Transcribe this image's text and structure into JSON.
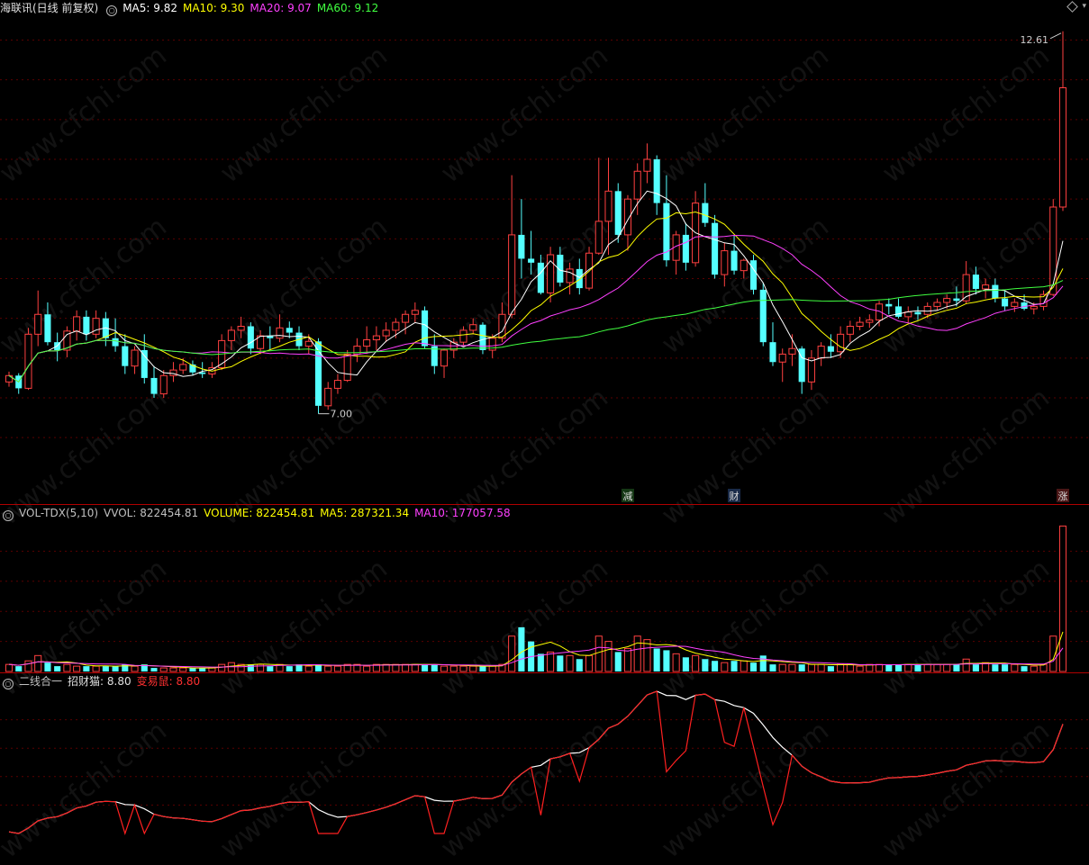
{
  "stock_name": "海联讯(日线 前复权)",
  "main_indicators": {
    "ma5": "MA5: 9.82",
    "ma10": "MA10: 9.30",
    "ma20": "MA20: 9.07",
    "ma60": "MA60: 9.12"
  },
  "price_labels": {
    "high": "12.61",
    "low": "7.00"
  },
  "event_markers": [
    "减",
    "财",
    "涨"
  ],
  "volume_panel": {
    "name": "VOL-TDX(5,10)",
    "vvol": "VVOL: 822454.81",
    "volume": "VOLUME: 822454.81",
    "ma5": "MA5: 287321.34",
    "ma10": "MA10: 177057.58"
  },
  "signal_panel": {
    "name": "二线合一",
    "line1": "招财猫: 8.80",
    "line2": "变易鼠: 8.80"
  },
  "watermark": "www.cfchi.com",
  "colors": {
    "up": "#ff4040",
    "down": "#54ffff",
    "ma5": "#ffffff",
    "ma10": "#ffff00",
    "ma20": "#ff40ff",
    "ma60": "#40ff40",
    "signal_white": "#ffffff",
    "signal_red": "#ff2020"
  },
  "chart_data": [
    {
      "type": "candlestick",
      "title": "海联讯(日线 前复权)",
      "ylim": [
        6.8,
        12.8
      ],
      "series": [
        {
          "name": "K",
          "ohlc": [
            [
              8.2,
              8.33,
              8.14,
              8.28
            ],
            [
              8.28,
              8.31,
              8.05,
              8.12
            ],
            [
              8.12,
              8.88,
              8.1,
              8.8
            ],
            [
              8.8,
              9.35,
              8.65,
              9.05
            ],
            [
              9.05,
              9.2,
              8.66,
              8.7
            ],
            [
              8.7,
              8.82,
              8.46,
              8.6
            ],
            [
              8.6,
              8.9,
              8.51,
              8.84
            ],
            [
              8.84,
              9.1,
              8.72,
              9.02
            ],
            [
              9.02,
              9.1,
              8.72,
              8.8
            ],
            [
              8.8,
              9.1,
              8.75,
              9.0
            ],
            [
              9.0,
              9.08,
              8.65,
              8.75
            ],
            [
              8.75,
              9.0,
              8.58,
              8.65
            ],
            [
              8.65,
              8.8,
              8.3,
              8.4
            ],
            [
              8.4,
              8.65,
              8.3,
              8.6
            ],
            [
              8.6,
              8.8,
              8.18,
              8.25
            ],
            [
              8.25,
              8.4,
              8.0,
              8.05
            ],
            [
              8.05,
              8.35,
              8.0,
              8.28
            ],
            [
              8.28,
              8.45,
              8.2,
              8.35
            ],
            [
              8.35,
              8.5,
              8.3,
              8.42
            ],
            [
              8.42,
              8.47,
              8.28,
              8.32
            ],
            [
              8.32,
              8.45,
              8.25,
              8.3
            ],
            [
              8.3,
              8.45,
              8.25,
              8.38
            ],
            [
              8.38,
              8.8,
              8.35,
              8.72
            ],
            [
              8.72,
              8.9,
              8.6,
              8.85
            ],
            [
              8.85,
              9.02,
              8.75,
              8.9
            ],
            [
              8.9,
              8.95,
              8.55,
              8.62
            ],
            [
              8.62,
              8.85,
              8.55,
              8.78
            ],
            [
              8.78,
              8.9,
              8.6,
              8.75
            ],
            [
              8.75,
              9.05,
              8.7,
              8.88
            ],
            [
              8.88,
              8.96,
              8.75,
              8.82
            ],
            [
              8.82,
              8.9,
              8.6,
              8.65
            ],
            [
              8.65,
              8.8,
              8.55,
              8.71
            ],
            [
              8.71,
              8.75,
              7.8,
              7.9
            ],
            [
              7.9,
              8.2,
              7.85,
              8.12
            ],
            [
              8.12,
              8.3,
              8.05,
              8.22
            ],
            [
              8.22,
              8.6,
              8.2,
              8.55
            ],
            [
              8.55,
              8.75,
              8.45,
              8.65
            ],
            [
              8.65,
              8.9,
              8.55,
              8.73
            ],
            [
              8.73,
              8.9,
              8.6,
              8.78
            ],
            [
              8.78,
              8.95,
              8.7,
              8.85
            ],
            [
              8.85,
              9.0,
              8.75,
              8.95
            ],
            [
              8.95,
              9.1,
              8.8,
              9.05
            ],
            [
              9.05,
              9.2,
              8.95,
              9.1
            ],
            [
              9.1,
              9.15,
              8.62,
              8.65
            ],
            [
              8.65,
              8.8,
              8.3,
              8.4
            ],
            [
              8.4,
              8.62,
              8.25,
              8.6
            ],
            [
              8.6,
              8.75,
              8.5,
              8.7
            ],
            [
              8.7,
              8.9,
              8.65,
              8.85
            ],
            [
              8.85,
              9.0,
              8.8,
              8.92
            ],
            [
              8.92,
              8.95,
              8.55,
              8.6
            ],
            [
              8.6,
              8.8,
              8.5,
              8.75
            ],
            [
              8.75,
              9.2,
              8.7,
              9.05
            ],
            [
              9.05,
              10.8,
              9.0,
              10.05
            ],
            [
              10.05,
              10.5,
              9.5,
              9.75
            ],
            [
              9.75,
              10.1,
              9.55,
              9.7
            ],
            [
              9.7,
              9.8,
              9.3,
              9.32
            ],
            [
              9.32,
              9.9,
              9.2,
              9.8
            ],
            [
              9.8,
              9.9,
              9.4,
              9.45
            ],
            [
              9.45,
              9.7,
              9.3,
              9.62
            ],
            [
              9.62,
              9.75,
              9.3,
              9.38
            ],
            [
              9.38,
              9.9,
              9.35,
              9.82
            ],
            [
              9.82,
              11.02,
              9.8,
              10.22
            ],
            [
              10.22,
              11.02,
              9.8,
              10.6
            ],
            [
              10.6,
              10.7,
              9.95,
              10.05
            ],
            [
              10.05,
              10.55,
              9.85,
              10.5
            ],
            [
              10.5,
              10.95,
              10.3,
              10.85
            ],
            [
              10.85,
              11.2,
              10.7,
              11.0
            ],
            [
              11.0,
              11.05,
              10.3,
              10.45
            ],
            [
              10.45,
              10.8,
              9.65,
              9.73
            ],
            [
              9.73,
              10.1,
              9.55,
              10.05
            ],
            [
              10.05,
              10.2,
              9.6,
              9.7
            ],
            [
              9.7,
              10.6,
              9.65,
              10.45
            ],
            [
              10.45,
              10.7,
              10.15,
              10.2
            ],
            [
              10.2,
              10.3,
              9.5,
              9.55
            ],
            [
              9.55,
              9.95,
              9.4,
              9.85
            ],
            [
              9.85,
              10.05,
              9.55,
              9.6
            ],
            [
              9.6,
              9.75,
              9.5,
              9.73
            ],
            [
              9.73,
              9.8,
              9.3,
              9.36
            ],
            [
              9.36,
              9.45,
              8.65,
              8.7
            ],
            [
              8.7,
              8.95,
              8.4,
              8.45
            ],
            [
              8.45,
              8.62,
              8.2,
              8.55
            ],
            [
              8.55,
              8.8,
              8.4,
              8.62
            ],
            [
              8.62,
              8.65,
              8.05,
              8.2
            ],
            [
              8.2,
              8.6,
              8.1,
              8.5
            ],
            [
              8.5,
              8.7,
              8.4,
              8.65
            ],
            [
              8.65,
              8.8,
              8.5,
              8.58
            ],
            [
              8.58,
              8.9,
              8.5,
              8.8
            ],
            [
              8.8,
              8.97,
              8.7,
              8.9
            ],
            [
              8.9,
              9.02,
              8.85,
              8.95
            ],
            [
              8.95,
              9.05,
              8.88,
              8.98
            ],
            [
              8.98,
              9.22,
              8.9,
              9.18
            ],
            [
              9.18,
              9.25,
              9.05,
              9.15
            ],
            [
              9.15,
              9.25,
              9.0,
              9.02
            ],
            [
              9.02,
              9.15,
              8.95,
              9.08
            ],
            [
              9.08,
              9.15,
              8.98,
              9.05
            ],
            [
              9.05,
              9.2,
              9.0,
              9.15
            ],
            [
              9.15,
              9.25,
              9.1,
              9.2
            ],
            [
              9.2,
              9.3,
              9.12,
              9.25
            ],
            [
              9.25,
              9.4,
              9.15,
              9.22
            ],
            [
              9.22,
              9.72,
              9.18,
              9.55
            ],
            [
              9.55,
              9.65,
              9.3,
              9.37
            ],
            [
              9.37,
              9.5,
              9.25,
              9.42
            ],
            [
              9.42,
              9.5,
              9.2,
              9.25
            ],
            [
              9.25,
              9.35,
              9.1,
              9.15
            ],
            [
              9.15,
              9.25,
              9.08,
              9.2
            ],
            [
              9.2,
              9.3,
              9.1,
              9.12
            ],
            [
              9.12,
              9.2,
              9.05,
              9.15
            ],
            [
              9.15,
              9.35,
              9.1,
              9.3
            ],
            [
              9.3,
              10.5,
              9.28,
              10.4
            ],
            [
              10.4,
              12.61,
              10.35,
              11.9
            ]
          ]
        },
        {
          "name": "MA5",
          "values": [
            9.82
          ]
        },
        {
          "name": "MA10",
          "values": [
            9.3
          ]
        },
        {
          "name": "MA20",
          "values": [
            9.07
          ]
        },
        {
          "name": "MA60",
          "values": [
            9.12
          ]
        }
      ],
      "annotations": [
        {
          "label": "12.61",
          "value": 12.61
        },
        {
          "label": "7.00",
          "value": 7.0
        }
      ]
    },
    {
      "type": "bar",
      "title": "VOL-TDX(5,10)",
      "series": [
        {
          "name": "VOLUME",
          "values": [
            40000,
            30000,
            60000,
            90000,
            50000,
            30000,
            40000,
            30000,
            30000,
            30000,
            30000,
            30000,
            40000,
            30000,
            40000,
            20000,
            20000,
            20000,
            20000,
            20000,
            20000,
            20000,
            40000,
            50000,
            40000,
            40000,
            40000,
            30000,
            40000,
            30000,
            40000,
            30000,
            40000,
            30000,
            30000,
            40000,
            40000,
            30000,
            40000,
            40000,
            40000,
            40000,
            40000,
            40000,
            40000,
            30000,
            30000,
            30000,
            30000,
            30000,
            30000,
            40000,
            200000,
            250000,
            170000,
            100000,
            110000,
            90000,
            90000,
            70000,
            90000,
            200000,
            170000,
            110000,
            130000,
            200000,
            180000,
            130000,
            120000,
            100000,
            80000,
            90000,
            70000,
            60000,
            50000,
            60000,
            60000,
            50000,
            90000,
            40000,
            40000,
            40000,
            40000,
            40000,
            40000,
            30000,
            40000,
            40000,
            30000,
            40000,
            40000,
            40000,
            40000,
            40000,
            40000,
            40000,
            40000,
            40000,
            40000,
            70000,
            40000,
            50000,
            40000,
            40000,
            40000,
            30000,
            30000,
            40000,
            200000,
            822454.81
          ]
        },
        {
          "name": "MA5",
          "values": [
            287321.34
          ]
        },
        {
          "name": "MA10",
          "values": [
            177057.58
          ]
        }
      ]
    },
    {
      "type": "line",
      "title": "二线合一",
      "series": [
        {
          "name": "招财猫",
          "values": [
            8.8
          ]
        },
        {
          "name": "变易鼠",
          "values": [
            8.8
          ]
        }
      ]
    }
  ]
}
